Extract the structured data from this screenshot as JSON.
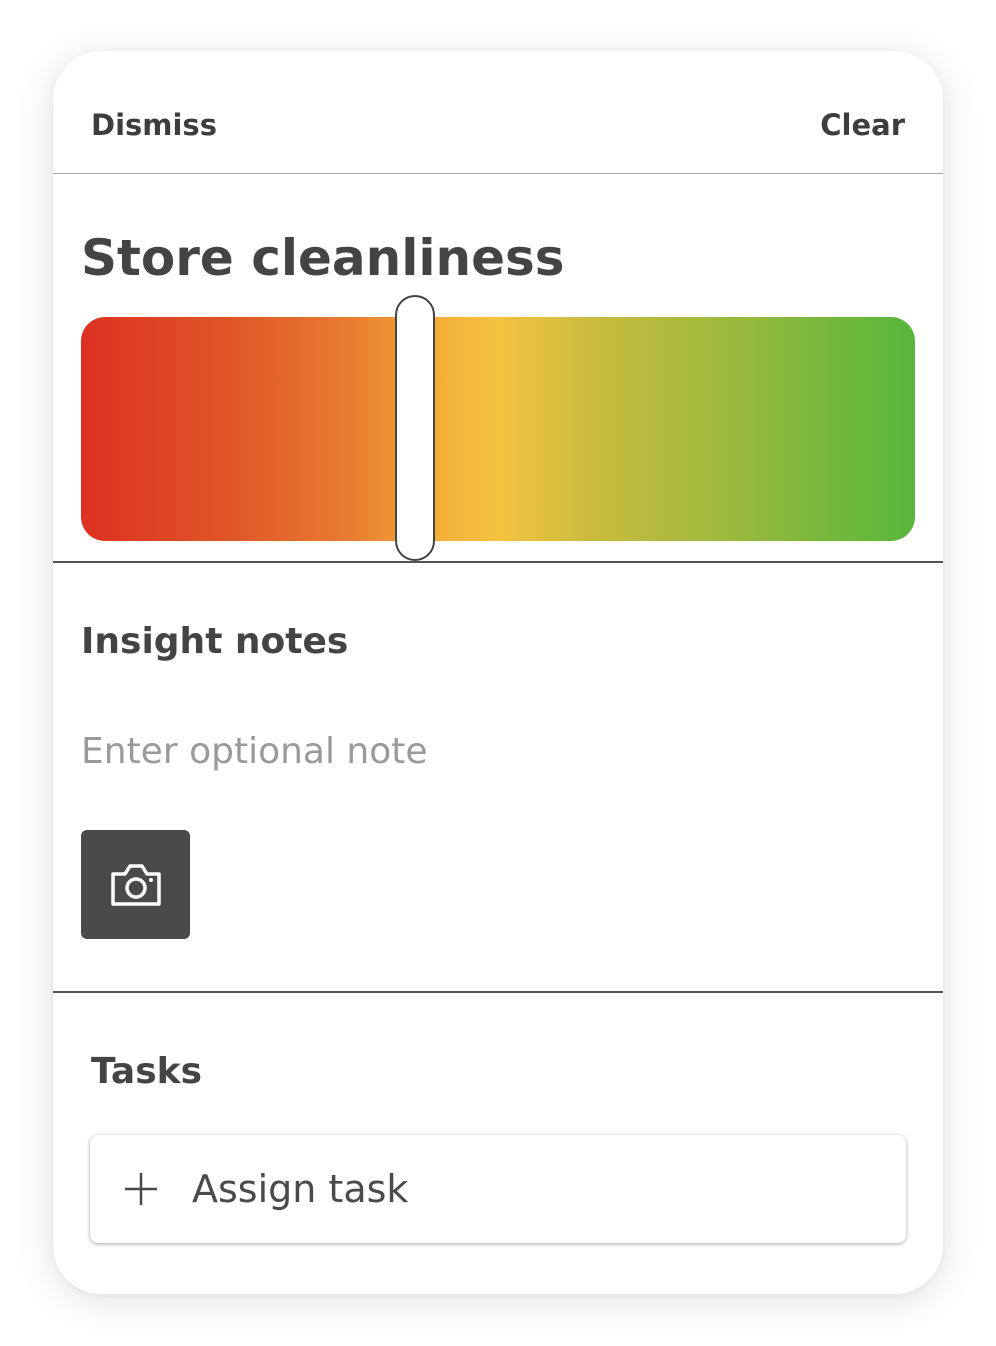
{
  "header": {
    "dismiss_label": "Dismiss",
    "clear_label": "Clear"
  },
  "rating": {
    "title": "Store cleanliness",
    "value_fraction": 0.4,
    "gradient_colors": [
      "#dc3122",
      "#ea7f31",
      "#f5c240",
      "#95b93d",
      "#56b73c"
    ]
  },
  "notes": {
    "title": "Insight notes",
    "placeholder": "Enter optional note",
    "value": "",
    "camera_icon": "camera-icon"
  },
  "tasks": {
    "title": "Tasks",
    "assign_label": "Assign task",
    "assign_icon": "plus-icon"
  },
  "colors": {
    "text_dark": "#444444",
    "camera_button_bg": "#4a4a4a",
    "placeholder": "#9a9a9a"
  }
}
